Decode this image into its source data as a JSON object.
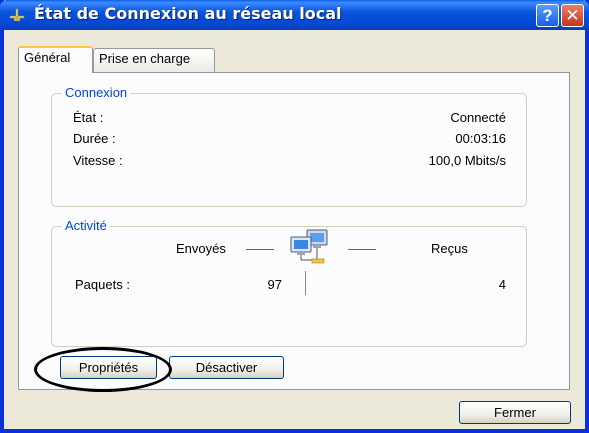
{
  "window": {
    "title": "État de Connexion au réseau local",
    "help_glyph": "?",
    "close_glyph": "✕"
  },
  "tabs": [
    {
      "label": "Général",
      "active": true
    },
    {
      "label": "Prise en charge",
      "active": false
    }
  ],
  "connexion": {
    "legend": "Connexion",
    "rows": [
      {
        "label": "État :",
        "value": "Connecté"
      },
      {
        "label": "Durée :",
        "value": "00:03:16"
      },
      {
        "label": "Vitesse :",
        "value": "100,0 Mbits/s"
      }
    ]
  },
  "activite": {
    "legend": "Activité",
    "sent_label": "Envoyés",
    "received_label": "Reçus",
    "packets_label": "Paquets :",
    "packets_sent": "97",
    "packets_received": "4",
    "icon": "network-computers-icon"
  },
  "buttons": {
    "properties": "Propriétés",
    "disable": "Désactiver",
    "close": "Fermer"
  },
  "colors": {
    "titlebar": "#0855dd",
    "group_legend": "#0046d5",
    "tab_highlight": "#ffc83c",
    "close_button": "#c2381a"
  }
}
